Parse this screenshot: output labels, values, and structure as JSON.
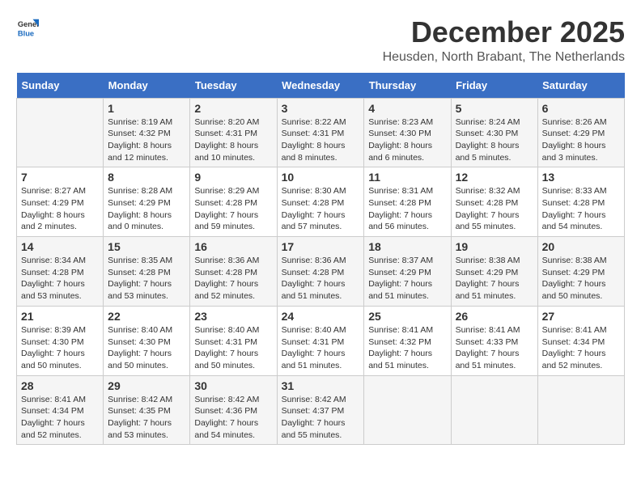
{
  "logo": {
    "general": "General",
    "blue": "Blue"
  },
  "title": {
    "month": "December 2025",
    "location": "Heusden, North Brabant, The Netherlands"
  },
  "headers": [
    "Sunday",
    "Monday",
    "Tuesday",
    "Wednesday",
    "Thursday",
    "Friday",
    "Saturday"
  ],
  "weeks": [
    [
      {
        "day": "",
        "info": ""
      },
      {
        "day": "1",
        "info": "Sunrise: 8:19 AM\nSunset: 4:32 PM\nDaylight: 8 hours\nand 12 minutes."
      },
      {
        "day": "2",
        "info": "Sunrise: 8:20 AM\nSunset: 4:31 PM\nDaylight: 8 hours\nand 10 minutes."
      },
      {
        "day": "3",
        "info": "Sunrise: 8:22 AM\nSunset: 4:31 PM\nDaylight: 8 hours\nand 8 minutes."
      },
      {
        "day": "4",
        "info": "Sunrise: 8:23 AM\nSunset: 4:30 PM\nDaylight: 8 hours\nand 6 minutes."
      },
      {
        "day": "5",
        "info": "Sunrise: 8:24 AM\nSunset: 4:30 PM\nDaylight: 8 hours\nand 5 minutes."
      },
      {
        "day": "6",
        "info": "Sunrise: 8:26 AM\nSunset: 4:29 PM\nDaylight: 8 hours\nand 3 minutes."
      }
    ],
    [
      {
        "day": "7",
        "info": "Sunrise: 8:27 AM\nSunset: 4:29 PM\nDaylight: 8 hours\nand 2 minutes."
      },
      {
        "day": "8",
        "info": "Sunrise: 8:28 AM\nSunset: 4:29 PM\nDaylight: 8 hours\nand 0 minutes."
      },
      {
        "day": "9",
        "info": "Sunrise: 8:29 AM\nSunset: 4:28 PM\nDaylight: 7 hours\nand 59 minutes."
      },
      {
        "day": "10",
        "info": "Sunrise: 8:30 AM\nSunset: 4:28 PM\nDaylight: 7 hours\nand 57 minutes."
      },
      {
        "day": "11",
        "info": "Sunrise: 8:31 AM\nSunset: 4:28 PM\nDaylight: 7 hours\nand 56 minutes."
      },
      {
        "day": "12",
        "info": "Sunrise: 8:32 AM\nSunset: 4:28 PM\nDaylight: 7 hours\nand 55 minutes."
      },
      {
        "day": "13",
        "info": "Sunrise: 8:33 AM\nSunset: 4:28 PM\nDaylight: 7 hours\nand 54 minutes."
      }
    ],
    [
      {
        "day": "14",
        "info": "Sunrise: 8:34 AM\nSunset: 4:28 PM\nDaylight: 7 hours\nand 53 minutes."
      },
      {
        "day": "15",
        "info": "Sunrise: 8:35 AM\nSunset: 4:28 PM\nDaylight: 7 hours\nand 53 minutes."
      },
      {
        "day": "16",
        "info": "Sunrise: 8:36 AM\nSunset: 4:28 PM\nDaylight: 7 hours\nand 52 minutes."
      },
      {
        "day": "17",
        "info": "Sunrise: 8:36 AM\nSunset: 4:28 PM\nDaylight: 7 hours\nand 51 minutes."
      },
      {
        "day": "18",
        "info": "Sunrise: 8:37 AM\nSunset: 4:29 PM\nDaylight: 7 hours\nand 51 minutes."
      },
      {
        "day": "19",
        "info": "Sunrise: 8:38 AM\nSunset: 4:29 PM\nDaylight: 7 hours\nand 51 minutes."
      },
      {
        "day": "20",
        "info": "Sunrise: 8:38 AM\nSunset: 4:29 PM\nDaylight: 7 hours\nand 50 minutes."
      }
    ],
    [
      {
        "day": "21",
        "info": "Sunrise: 8:39 AM\nSunset: 4:30 PM\nDaylight: 7 hours\nand 50 minutes."
      },
      {
        "day": "22",
        "info": "Sunrise: 8:40 AM\nSunset: 4:30 PM\nDaylight: 7 hours\nand 50 minutes."
      },
      {
        "day": "23",
        "info": "Sunrise: 8:40 AM\nSunset: 4:31 PM\nDaylight: 7 hours\nand 50 minutes."
      },
      {
        "day": "24",
        "info": "Sunrise: 8:40 AM\nSunset: 4:31 PM\nDaylight: 7 hours\nand 51 minutes."
      },
      {
        "day": "25",
        "info": "Sunrise: 8:41 AM\nSunset: 4:32 PM\nDaylight: 7 hours\nand 51 minutes."
      },
      {
        "day": "26",
        "info": "Sunrise: 8:41 AM\nSunset: 4:33 PM\nDaylight: 7 hours\nand 51 minutes."
      },
      {
        "day": "27",
        "info": "Sunrise: 8:41 AM\nSunset: 4:34 PM\nDaylight: 7 hours\nand 52 minutes."
      }
    ],
    [
      {
        "day": "28",
        "info": "Sunrise: 8:41 AM\nSunset: 4:34 PM\nDaylight: 7 hours\nand 52 minutes."
      },
      {
        "day": "29",
        "info": "Sunrise: 8:42 AM\nSunset: 4:35 PM\nDaylight: 7 hours\nand 53 minutes."
      },
      {
        "day": "30",
        "info": "Sunrise: 8:42 AM\nSunset: 4:36 PM\nDaylight: 7 hours\nand 54 minutes."
      },
      {
        "day": "31",
        "info": "Sunrise: 8:42 AM\nSunset: 4:37 PM\nDaylight: 7 hours\nand 55 minutes."
      },
      {
        "day": "",
        "info": ""
      },
      {
        "day": "",
        "info": ""
      },
      {
        "day": "",
        "info": ""
      }
    ]
  ]
}
